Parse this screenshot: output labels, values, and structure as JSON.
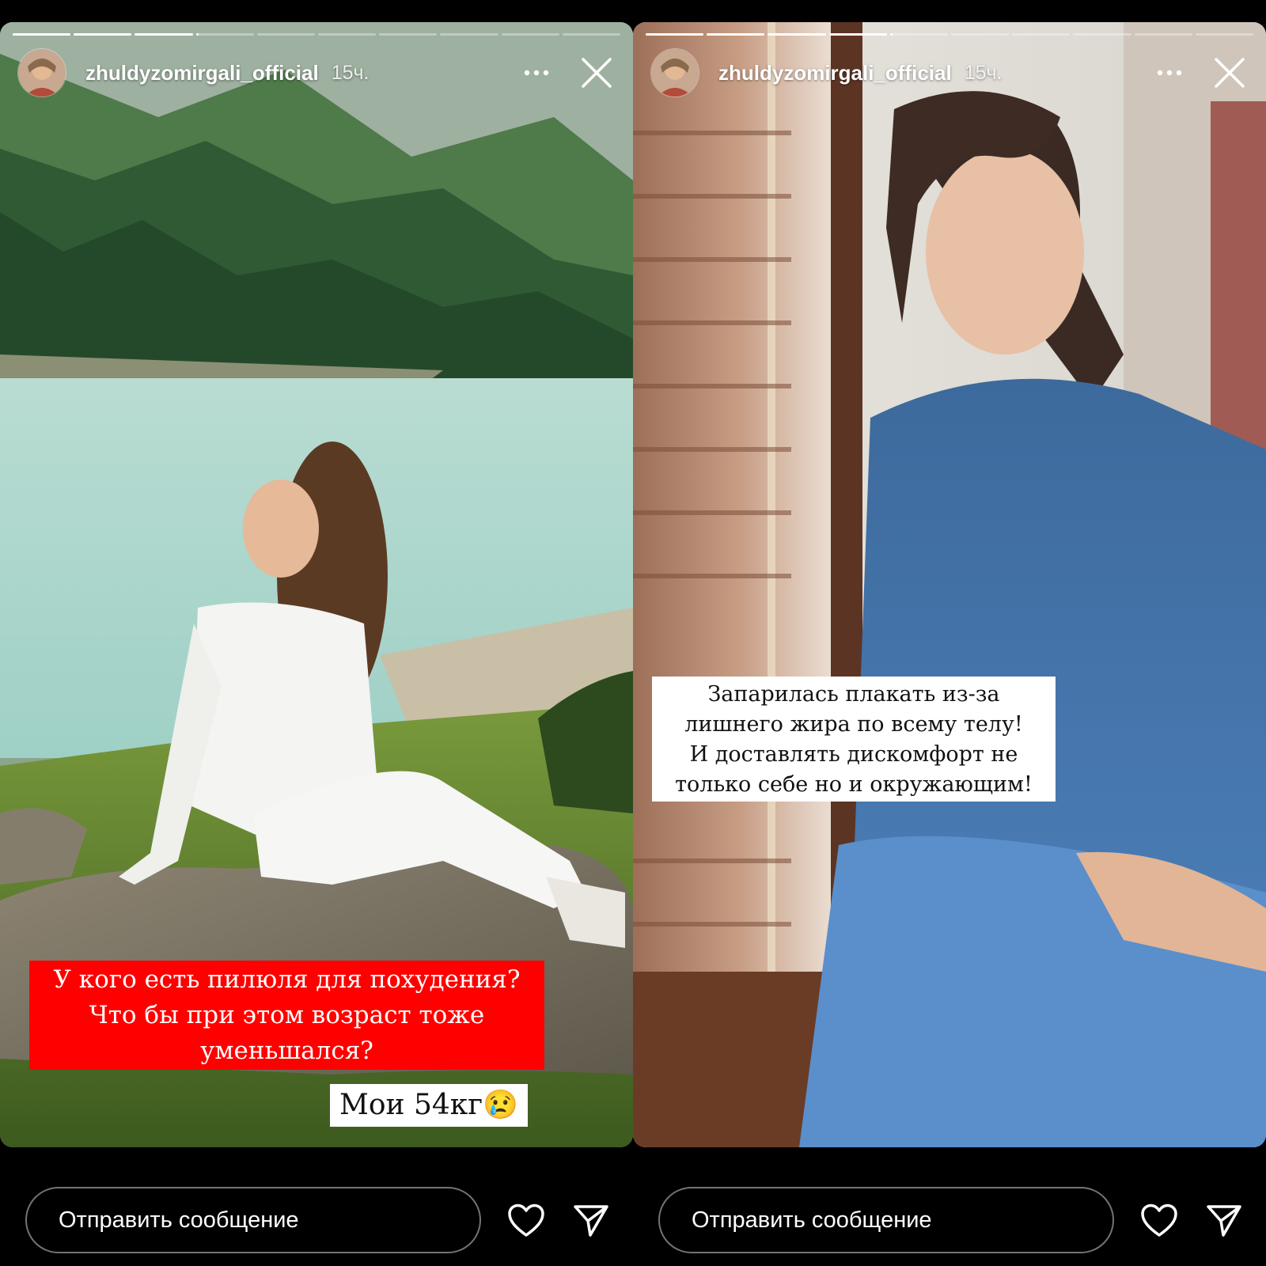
{
  "stories": [
    {
      "username": "zhuldyzomirgali_official",
      "time": "15ч.",
      "progress": [
        1,
        1,
        1,
        0.05,
        0,
        0,
        0,
        0,
        0,
        0
      ],
      "captions": {
        "red": [
          "У кого есть пилюля для похудения?",
          "Что бы при этом возраст тоже",
          "уменьшался?"
        ],
        "weight": "Мои 54кг😢"
      },
      "message_placeholder": "Отправить сообщение"
    },
    {
      "username": "zhuldyzomirgali_official",
      "time": "15ч.",
      "progress": [
        1,
        1,
        1,
        1,
        0.05,
        0,
        0,
        0,
        0,
        0
      ],
      "captions": {
        "white": [
          "Запарилась плакать из-за",
          "лишнего жира по всему телу!",
          "И доставлять дискомфорт не",
          "только себе но и окружающим!"
        ]
      },
      "message_placeholder": "Отправить сообщение"
    }
  ],
  "icons": {
    "more": "more-horizontal-icon",
    "close": "close-icon",
    "like": "heart-outline-icon",
    "share": "send-paper-plane-icon"
  },
  "colors": {
    "background": "#000000",
    "caption_red": "#ff0000",
    "caption_white": "#ffffff",
    "text": "#ffffff"
  }
}
